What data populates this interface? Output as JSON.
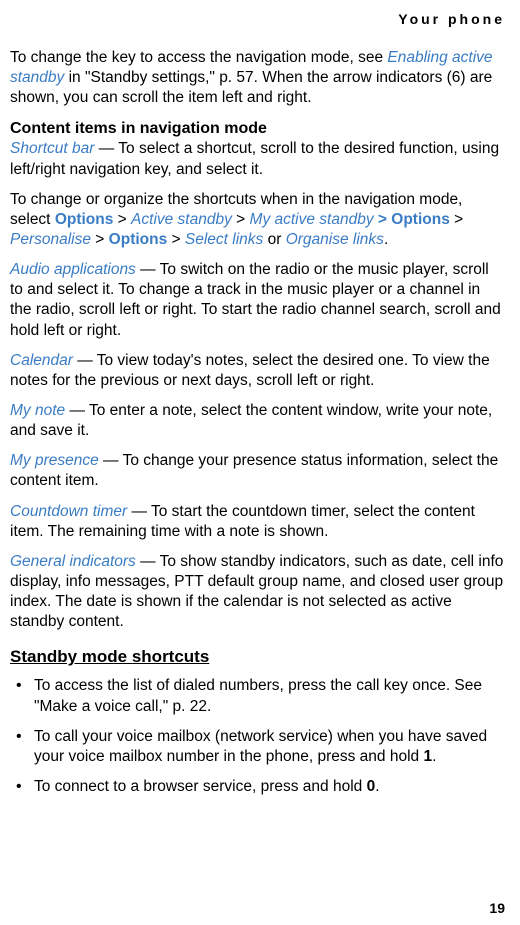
{
  "header": "Your phone",
  "para1_a": "To change the key to access the navigation mode, see ",
  "para1_link": "Enabling active standby",
  "para1_b": " in \"Standby settings,\" p. 57. When the arrow indicators (6) are shown, you can scroll the item left and right.",
  "section1_title": "Content items in navigation mode",
  "shortcut_term": "Shortcut bar",
  "shortcut_text": " — To select a shortcut, scroll to the desired function, using left/right navigation key, and select it.",
  "change_text_a": "To change or organize the shortcuts when in the navigation mode, select ",
  "options": "Options",
  "gt": " > ",
  "active_standby": "Active standby",
  "my_active_standby": "My active standby",
  "gt_bold": " > ",
  "personalise": "Personalise",
  "select_links": "Select links",
  "or": " or ",
  "organise_links": "Organise links",
  "period": ".",
  "audio_term": "Audio applications",
  "audio_text": " — To switch on the radio or the music player, scroll to and select it. To change a track in the music player or a channel in the radio, scroll left or right. To start the radio channel search, scroll and hold left or right.",
  "calendar_term": "Calendar",
  "calendar_text": " — To view today's notes, select the desired one. To view the notes for the previous or next days, scroll left or right.",
  "mynote_term": "My note",
  "mynote_text": " — To enter a note, select the content window, write your note, and save it.",
  "mypresence_term": "My presence",
  "mypresence_text": " — To change your presence status information, select the content item.",
  "countdown_term": "Countdown timer",
  "countdown_text": " — To start the countdown timer, select the content item. The remaining time with a note is shown.",
  "general_term": "General indicators",
  "general_text": " — To show standby indicators, such as date, cell info display, info messages, PTT default group name, and closed user group index. The date is shown if the calendar is not selected as active standby content.",
  "section2_title": "Standby mode shortcuts",
  "bullet1": "To access the list of dialed numbers, press the call key once. See \"Make a voice call,\" p. 22.",
  "bullet2_a": "To call your voice mailbox (network service) when you have saved your voice mailbox number in the phone, press and hold ",
  "bullet2_bold": "1",
  "bullet3_a": "To connect to a browser service, press and hold ",
  "bullet3_bold": "0",
  "page_num": "19"
}
